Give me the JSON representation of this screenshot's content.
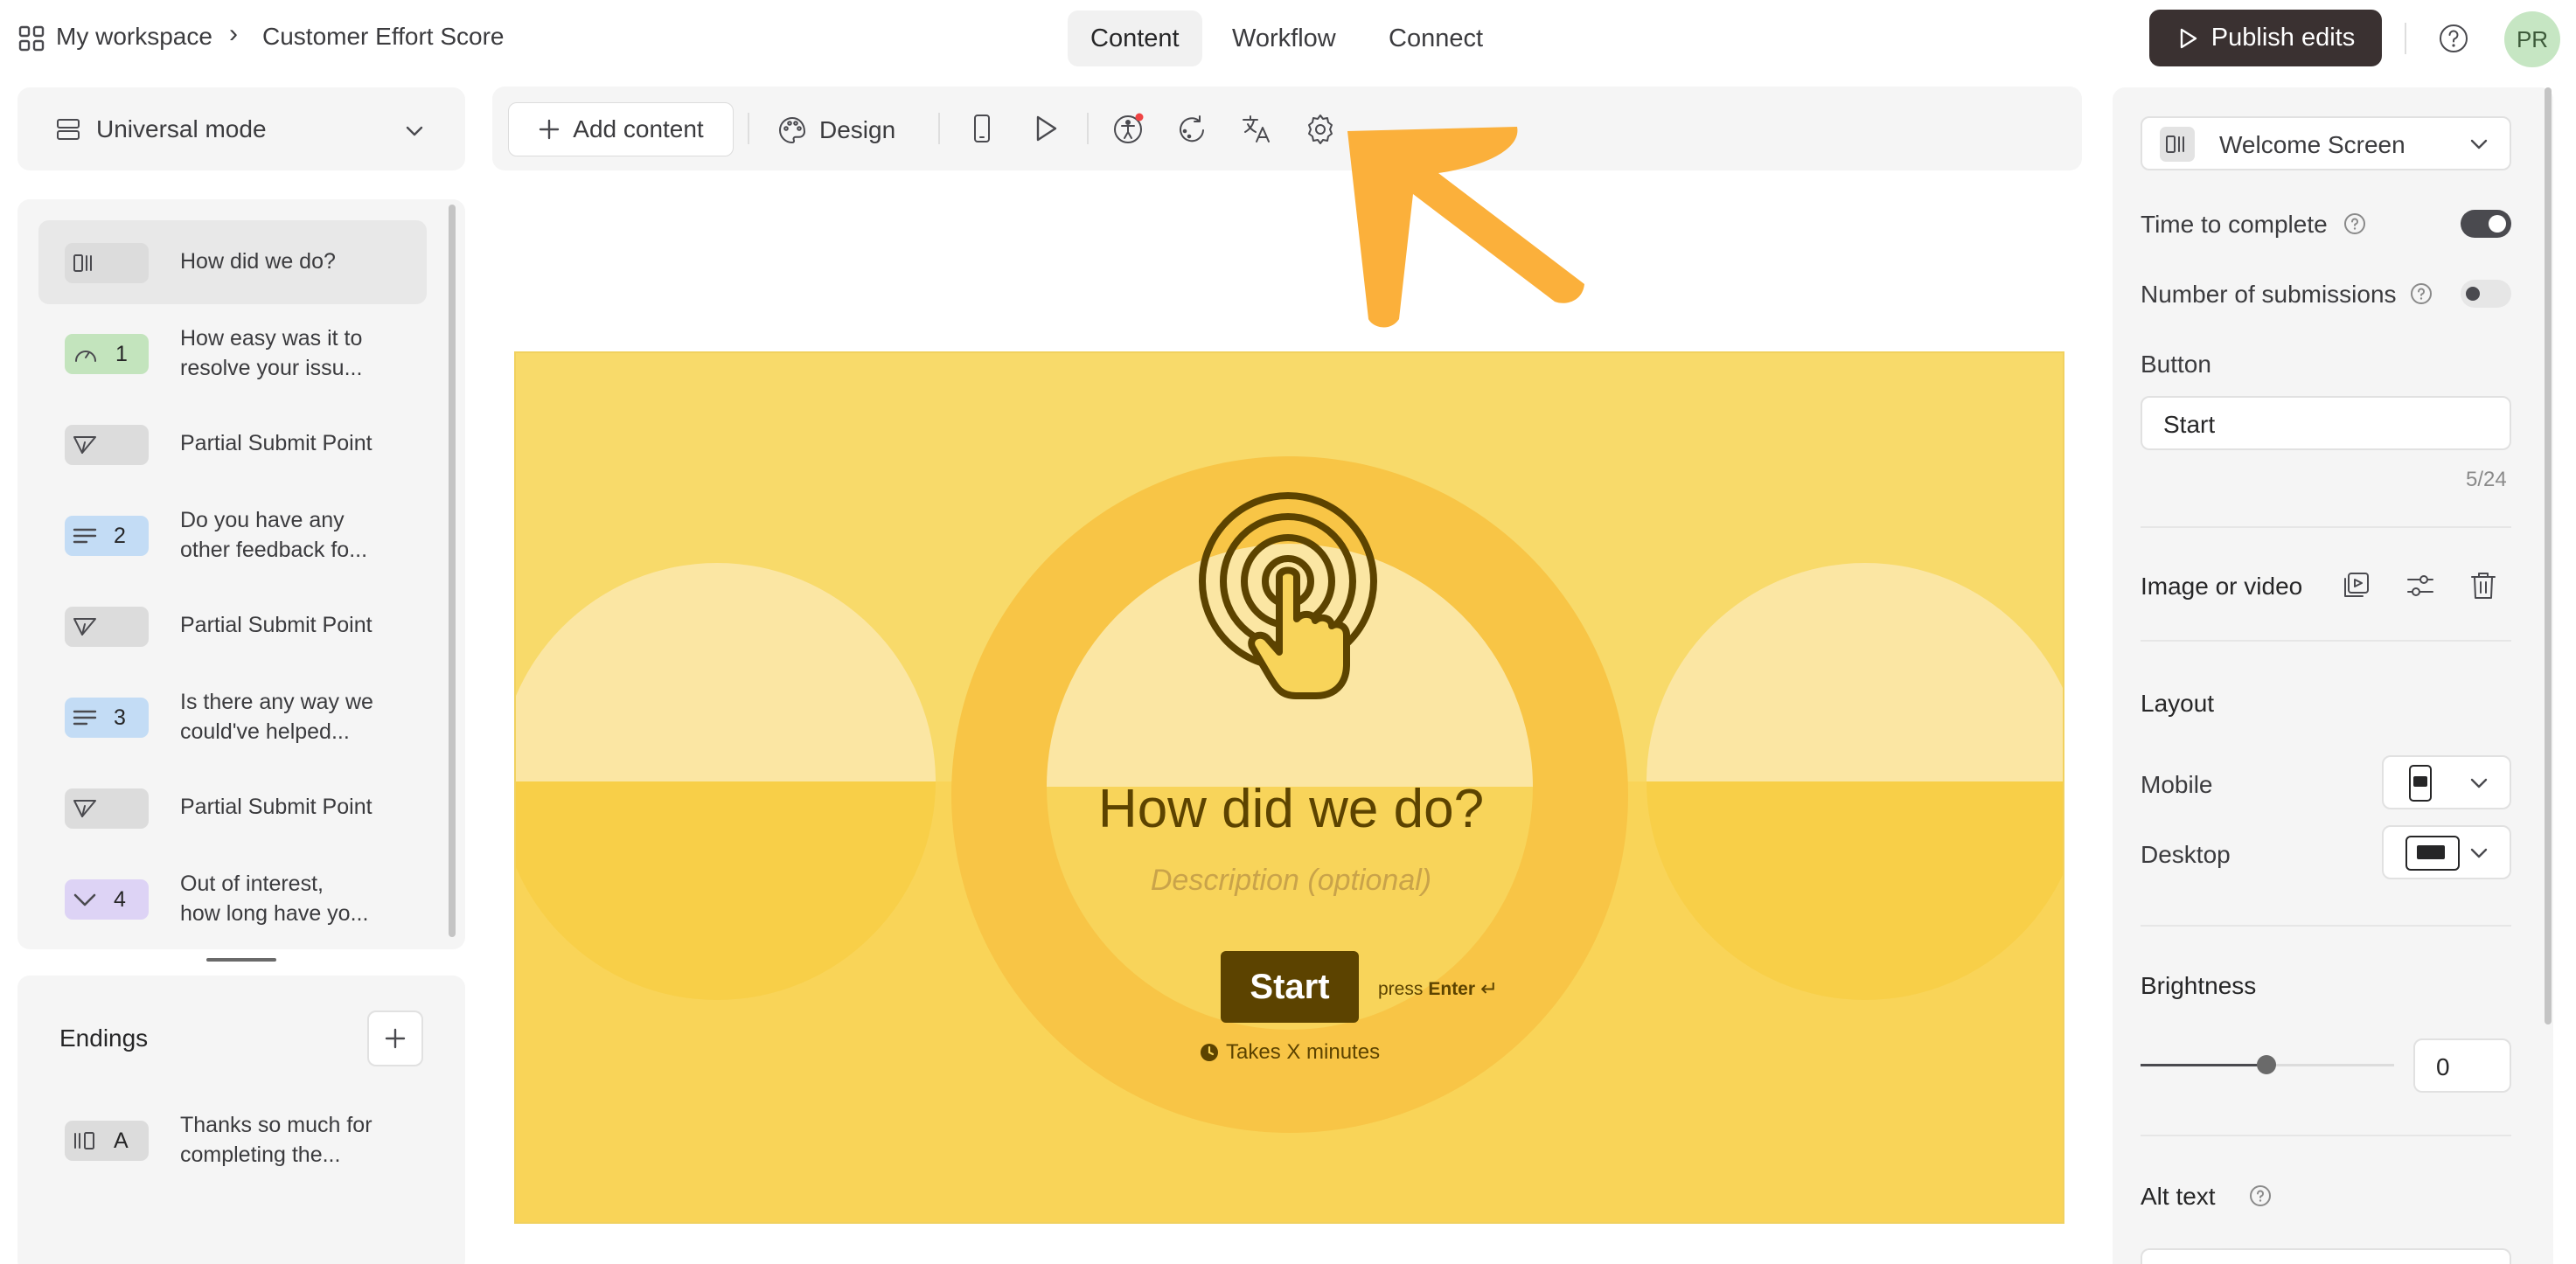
{
  "breadcrumb": {
    "workspace": "My workspace",
    "separator": "›",
    "form_name": "Customer Effort Score"
  },
  "nav_tabs": [
    {
      "label": "Content",
      "active": true
    },
    {
      "label": "Workflow",
      "active": false
    },
    {
      "label": "Connect",
      "active": false
    }
  ],
  "header": {
    "publish_label": "Publish edits",
    "avatar_initials": "PR",
    "help_icon": "help-circle-icon"
  },
  "mode_selector": {
    "label": "Universal mode"
  },
  "questions": [
    {
      "badge_icon": "welcome-screen-icon",
      "number": "",
      "line1": "How did we do?",
      "line2": "",
      "badge_color": "#dcdcdc",
      "selected": true
    },
    {
      "badge_icon": "gauge-icon",
      "number": "1",
      "line1": "How easy was it to",
      "line2": "resolve your issu...",
      "badge_color": "#c3e4bd",
      "selected": false
    },
    {
      "badge_icon": "send-icon",
      "number": "",
      "line1": "Partial Submit Point",
      "line2": "",
      "badge_color": "#dcdcdc",
      "selected": false
    },
    {
      "badge_icon": "long-text-icon",
      "number": "2",
      "line1": "Do you have any",
      "line2": "other feedback fo...",
      "badge_color": "#c3dcf5",
      "selected": false
    },
    {
      "badge_icon": "send-icon",
      "number": "",
      "line1": "Partial Submit Point",
      "line2": "",
      "badge_color": "#dcdcdc",
      "selected": false
    },
    {
      "badge_icon": "long-text-icon",
      "number": "3",
      "line1": "Is there any way we",
      "line2": "could've helped...",
      "badge_color": "#c3dcf5",
      "selected": false
    },
    {
      "badge_icon": "send-icon",
      "number": "",
      "line1": "Partial Submit Point",
      "line2": "",
      "badge_color": "#dcdcdc",
      "selected": false
    },
    {
      "badge_icon": "dropdown-icon",
      "number": "4",
      "line1": "Out of interest,",
      "line2": "how long have yo...",
      "badge_color": "#ddd3f5",
      "selected": false
    }
  ],
  "endings": {
    "title": "Endings",
    "items": [
      {
        "letter": "A",
        "line1": "Thanks so much for",
        "line2": "completing the..."
      }
    ]
  },
  "toolbar": {
    "add_content": "Add content",
    "design": "Design"
  },
  "canvas": {
    "background": "#f8da6a",
    "question_title": "How did we do?",
    "description_placeholder": "Description (optional)",
    "start_button": "Start",
    "press_text": "press",
    "enter_text": "Enter",
    "enter_symbol": "↵",
    "time_text": "Takes X minutes"
  },
  "right_panel": {
    "screen_type": "Welcome Screen",
    "time_to_complete": {
      "label": "Time to complete",
      "on": true
    },
    "number_of_submissions": {
      "label": "Number of submissions",
      "on": false
    },
    "button_label": "Button",
    "button_value": "Start",
    "char_count": "5/24",
    "image_or_video": "Image or video",
    "layout_heading": "Layout",
    "mobile_label": "Mobile",
    "desktop_label": "Desktop",
    "brightness_heading": "Brightness",
    "brightness_value": "0",
    "alt_text_heading": "Alt text"
  },
  "colors": {
    "accent_arrow": "#fbb03b",
    "publish_bg": "#3a3131",
    "start_button_bg": "#5c4300"
  }
}
